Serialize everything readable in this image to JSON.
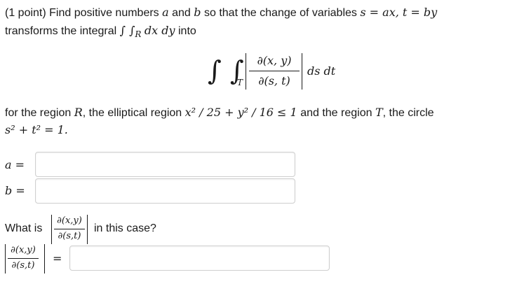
{
  "problem": {
    "points": "(1 point)",
    "line1_text": "Find positive numbers",
    "var_a": "a",
    "and_text": "and",
    "var_b": "b",
    "line1_tail": "so that the change of variables",
    "change_vars": "s = ax, t = by",
    "line2_text": "transforms the integral",
    "integral_R": "∫ ∫",
    "region_R_sub": "R",
    "dx_dy": "dx dy",
    "into_text": "into"
  },
  "display": {
    "integral": "∫ ∫",
    "region_T_sub": "T",
    "jac_num": "∂(x, y)",
    "jac_den": "∂(s, t)",
    "ds_dt": "ds dt"
  },
  "region_text": {
    "part1": "for the region",
    "R": "R",
    "part2": ", the elliptical region",
    "ellipse": "x² / 25 + y² / 16 ≤ 1",
    "part3": "and the region",
    "T": "T",
    "part4": ", the circle",
    "circle": "s² + t² = 1."
  },
  "answers": {
    "a_label": "a =",
    "b_label": "b =",
    "a_value": "",
    "b_value": ""
  },
  "question2": {
    "what_is": "What is",
    "jac_num": "∂(x,y)",
    "jac_den": "∂(s,t)",
    "in_this_case": "in this case?",
    "equals": "=",
    "value": ""
  }
}
